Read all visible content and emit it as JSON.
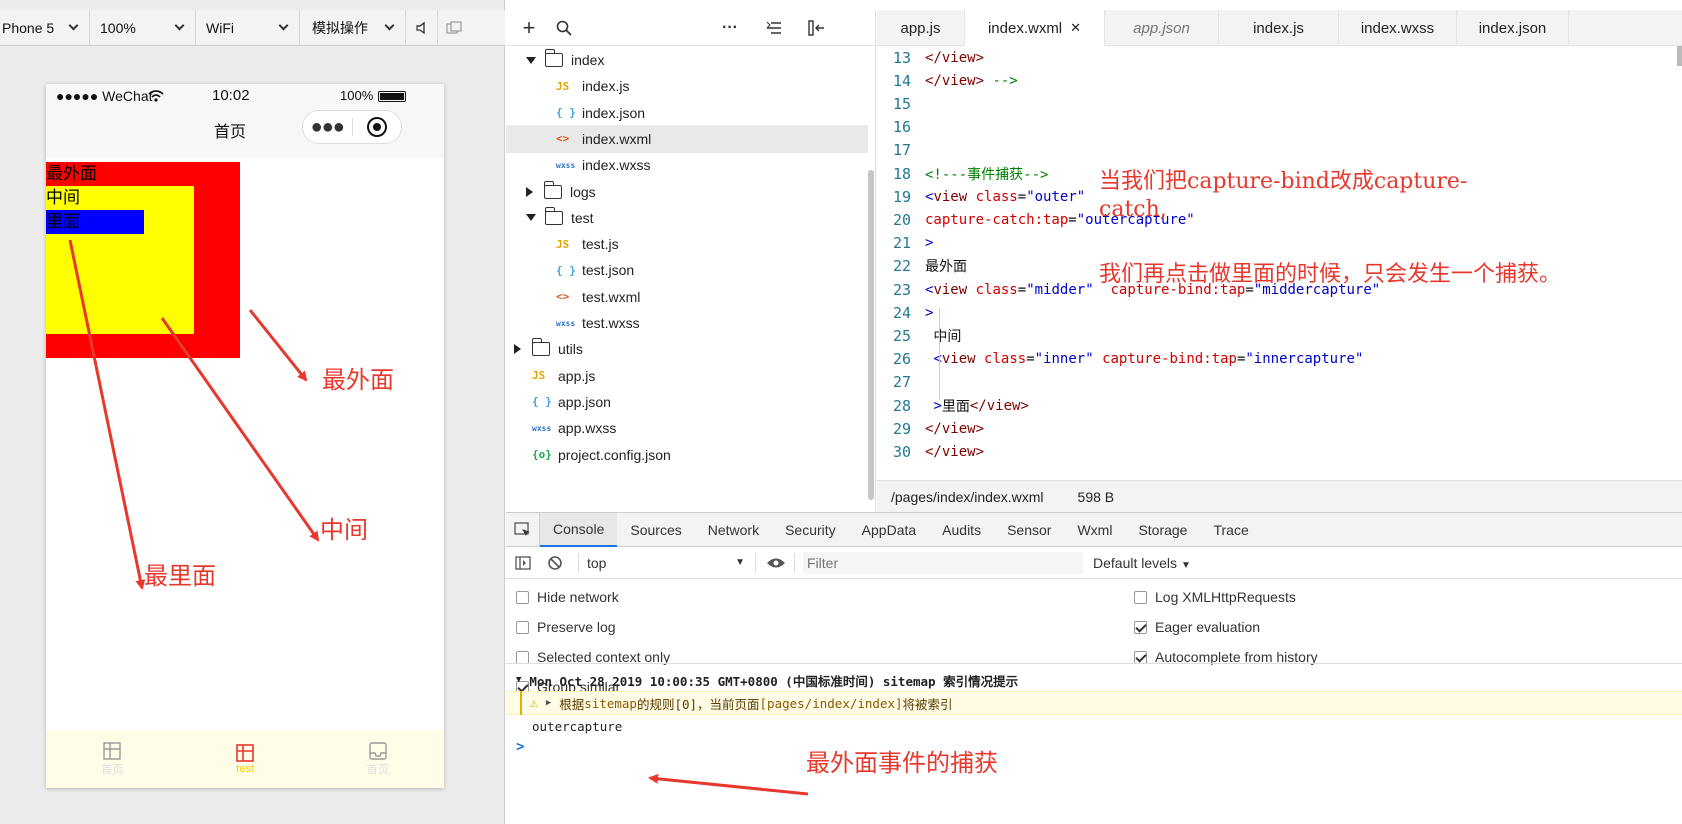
{
  "simulator": {
    "toolbar": {
      "device": "Phone 5",
      "zoom": "100%",
      "network": "WiFi",
      "mode": "模拟操作"
    },
    "status": {
      "carrier": "●●●●● WeChat",
      "time": "10:02",
      "battery": "100%"
    },
    "nav_title": "首页",
    "boxes": {
      "outer": "最外面",
      "middle": "中间",
      "inner": "里面"
    },
    "tabbar": [
      {
        "label": "首页"
      },
      {
        "label": "test"
      },
      {
        "label": "首页"
      }
    ]
  },
  "annotations": {
    "outer_arrow": "最外面",
    "middle_arrow": "中间",
    "inner_arrow": "最里面",
    "editor_note1": "当我们把capture-bind改成capture-catch,",
    "editor_note2": "我们再点击做里面的时候，只会发生一个捕获。",
    "log_note": "最外面事件的捕获"
  },
  "explorer": {
    "items": [
      {
        "label": "index",
        "kind": "folder-open",
        "depth": 1
      },
      {
        "label": "index.js",
        "kind": "js",
        "depth": 2
      },
      {
        "label": "index.json",
        "kind": "json",
        "depth": 2
      },
      {
        "label": "index.wxml",
        "kind": "wxml",
        "depth": 2,
        "selected": true
      },
      {
        "label": "index.wxss",
        "kind": "wxss",
        "depth": 2
      },
      {
        "label": "logs",
        "kind": "folder",
        "depth": 1
      },
      {
        "label": "test",
        "kind": "folder-open",
        "depth": 1
      },
      {
        "label": "test.js",
        "kind": "js",
        "depth": 2
      },
      {
        "label": "test.json",
        "kind": "json",
        "depth": 2
      },
      {
        "label": "test.wxml",
        "kind": "wxml",
        "depth": 2
      },
      {
        "label": "test.wxss",
        "kind": "wxss",
        "depth": 2
      },
      {
        "label": "utils",
        "kind": "folder",
        "depth": 0
      },
      {
        "label": "app.js",
        "kind": "js",
        "depth": 0
      },
      {
        "label": "app.json",
        "kind": "json",
        "depth": 0
      },
      {
        "label": "app.wxss",
        "kind": "wxss",
        "depth": 0
      },
      {
        "label": "project.config.json",
        "kind": "config",
        "depth": 0
      }
    ],
    "icons": {
      "js": "JS",
      "json": "{ }",
      "wxml": "<>",
      "wxss": "wxss",
      "config": "{o}"
    }
  },
  "editor": {
    "tabs": [
      {
        "label": "app.js"
      },
      {
        "label": "index.wxml",
        "active": true
      },
      {
        "label": "app.json",
        "preview": true
      },
      {
        "label": "index.js"
      },
      {
        "label": "index.wxss"
      },
      {
        "label": "index.json"
      }
    ],
    "lines": [
      {
        "n": "13",
        "parts": [
          [
            "tag",
            "</view>"
          ]
        ]
      },
      {
        "n": "14",
        "parts": [
          [
            "tag",
            "</view>"
          ],
          [
            "com",
            " -->"
          ]
        ]
      },
      {
        "n": "15",
        "parts": []
      },
      {
        "n": "16",
        "parts": []
      },
      {
        "n": "17",
        "parts": []
      },
      {
        "n": "18",
        "parts": [
          [
            "com",
            "<!---事件捕获-->"
          ]
        ]
      },
      {
        "n": "19",
        "parts": [
          [
            "brk",
            "<"
          ],
          [
            "tag",
            "view"
          ],
          [
            "txt",
            " "
          ],
          [
            "attr",
            "class"
          ],
          [
            "txt",
            "="
          ],
          [
            "val",
            "\"outer\""
          ]
        ]
      },
      {
        "n": "20",
        "parts": [
          [
            "attr",
            "capture-catch:tap"
          ],
          [
            "txt",
            "="
          ],
          [
            "val",
            "\"outercapture\""
          ]
        ]
      },
      {
        "n": "21",
        "parts": [
          [
            "brk",
            ">"
          ]
        ]
      },
      {
        "n": "22",
        "parts": [
          [
            "txt",
            "最外面"
          ]
        ]
      },
      {
        "n": "23",
        "parts": [
          [
            "brk",
            "<"
          ],
          [
            "tag",
            "view"
          ],
          [
            "txt",
            " "
          ],
          [
            "attr",
            "class"
          ],
          [
            "txt",
            "="
          ],
          [
            "val",
            "\"midder\""
          ],
          [
            "txt",
            "  "
          ],
          [
            "attr",
            "capture-bind:tap"
          ],
          [
            "txt",
            "="
          ],
          [
            "val",
            "\"middercapture\""
          ]
        ]
      },
      {
        "n": "24",
        "parts": [
          [
            "brk",
            ">"
          ]
        ]
      },
      {
        "n": "25",
        "parts": [
          [
            "txt",
            " 中间"
          ]
        ]
      },
      {
        "n": "26",
        "parts": [
          [
            "txt",
            " "
          ],
          [
            "brk",
            "<"
          ],
          [
            "tag",
            "view"
          ],
          [
            "txt",
            " "
          ],
          [
            "attr",
            "class"
          ],
          [
            "txt",
            "="
          ],
          [
            "val",
            "\"inner\""
          ],
          [
            "txt",
            " "
          ],
          [
            "attr",
            "capture-bind:tap"
          ],
          [
            "txt",
            "="
          ],
          [
            "val",
            "\"innercapture\""
          ]
        ]
      },
      {
        "n": "27",
        "parts": []
      },
      {
        "n": "28",
        "parts": [
          [
            "txt",
            " "
          ],
          [
            "brk",
            ">"
          ],
          [
            "txt",
            "里面"
          ],
          [
            "tag",
            "</view>"
          ]
        ]
      },
      {
        "n": "29",
        "parts": [
          [
            "tag",
            "</view>"
          ]
        ]
      },
      {
        "n": "30",
        "parts": [
          [
            "tag",
            "</view>"
          ]
        ]
      }
    ],
    "status_path": "/pages/index/index.wxml",
    "status_size": "598 B"
  },
  "devtools": {
    "tabs": [
      "Console",
      "Sources",
      "Network",
      "Security",
      "AppData",
      "Audits",
      "Sensor",
      "Wxml",
      "Storage",
      "Trace"
    ],
    "context": "top",
    "filter_placeholder": "Filter",
    "levels": "Default levels",
    "options_left": [
      {
        "label": "Hide network",
        "checked": false
      },
      {
        "label": "Preserve log",
        "checked": false
      },
      {
        "label": "Selected context only",
        "checked": false
      },
      {
        "label": "Group similar",
        "checked": true
      }
    ],
    "options_right": [
      {
        "label": "Log XMLHttpRequests",
        "checked": false
      },
      {
        "label": "Eager evaluation",
        "checked": true
      },
      {
        "label": "Autocomplete from history",
        "checked": true
      }
    ],
    "log_group": "Mon Oct 28 2019 10:00:35 GMT+0800 (中国标准时间) sitemap 索引情况提示",
    "log_warn_prefix": "根据 ",
    "log_warn_code1": "sitemap",
    "log_warn_mid": " 的规则[0]，当前页面 ",
    "log_warn_code2": "[pages/index/index]",
    "log_warn_suffix": " 将被索引",
    "log_output": "outercapture",
    "prompt": ">"
  },
  "colors": {
    "outer": "#ff0000",
    "middle": "#ffff00",
    "inner": "#0000ff",
    "annotation": "#e8382d"
  }
}
